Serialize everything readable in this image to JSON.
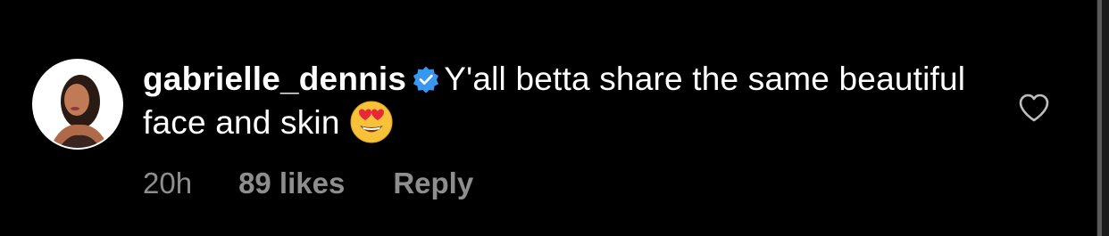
{
  "comment": {
    "username": "gabrielle_dennis",
    "verified_icon": "verified-badge-icon",
    "text": "Y'all betta share the same beautiful face and skin",
    "emoji_icon": "heart-eyes-emoji-icon",
    "timestamp": "20h",
    "likes": "89 likes",
    "reply_label": "Reply",
    "like_icon": "heart-outline-icon"
  },
  "colors": {
    "background": "#000000",
    "text": "#ffffff",
    "meta": "#8e8e8e",
    "verified": "#3897f0"
  }
}
